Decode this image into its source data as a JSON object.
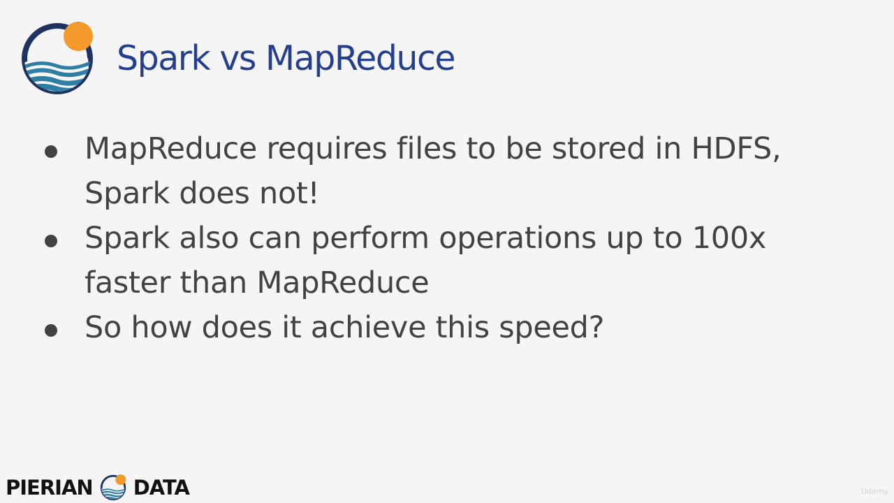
{
  "slide": {
    "title": "Spark vs MapReduce",
    "bullets": [
      {
        "lines": [
          "MapReduce requires files to be stored in HDFS,",
          "Spark does not!"
        ]
      },
      {
        "lines": [
          "Spark also can perform operations up to 100x",
          "faster than MapReduce"
        ]
      },
      {
        "lines": [
          "So how does it achieve this speed?"
        ]
      }
    ]
  },
  "branding": {
    "logo_left": "PIERIAN",
    "logo_right": "DATA",
    "watermark": "Udemy"
  },
  "colors": {
    "title": "#243f8f",
    "body_text": "#424242",
    "background": "#f5f5f5",
    "logo_ring": "#1f3261",
    "logo_sun": "#f39a2b",
    "logo_wave": "#2f7ea5"
  },
  "icons": {
    "header_logo": "pierian-data-logo-icon",
    "footer_logo": "pierian-data-logo-icon"
  }
}
